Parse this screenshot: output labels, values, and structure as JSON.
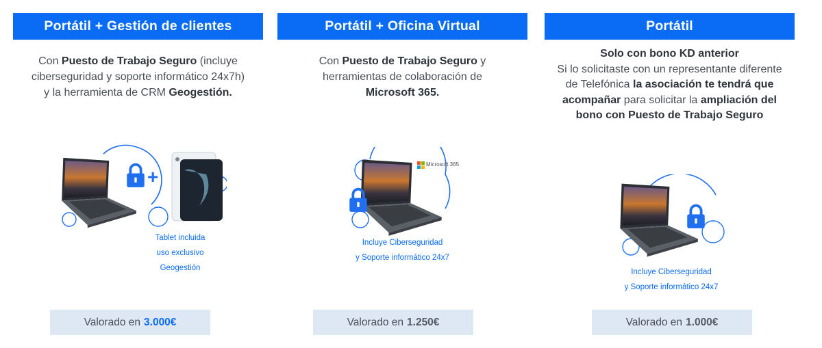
{
  "cards": [
    {
      "header": "Portátil + Gestión de clientes",
      "desc": {
        "p1": "Con ",
        "b1": "Puesto de Trabajo Seguro",
        "p2": " (incluye ciberseguridad y soporte informático 24x7h) y la herramienta de CRM ",
        "b2": "Geogestión."
      },
      "plus": "+",
      "caption": [
        "Tablet incluida",
        "uso exclusivo",
        "Geogestión"
      ],
      "price": {
        "label": "Valorado en",
        "amount": "3.000€"
      }
    },
    {
      "header": "Portátil + Oficina Virtual",
      "desc": {
        "p1": "Con ",
        "b1": "Puesto de Trabajo Seguro",
        "p2": " y herramientas de colaboración de ",
        "b2": "Microsoft 365."
      },
      "logo": "Microsoft 365",
      "caption": [
        "Incluye Ciberseguridad",
        "y Soporte informático 24x7"
      ],
      "price": {
        "label": "Valorado en",
        "amount": "1.250€"
      }
    },
    {
      "header": "Portátil",
      "desc": {
        "title": "Solo con bono KD anterior",
        "p1": "Si lo solicitaste con un representante diferente de Telefónica ",
        "b1": "la asociación te tendrá que acompañar",
        "p2": " para solicitar la ",
        "b2": "ampliación del bono con Puesto de Trabajo Seguro"
      },
      "caption": [
        "Incluye Ciberseguridad",
        "y Soporte informático 24x7"
      ],
      "price": {
        "label": "Valorado en",
        "amount": "1.000€"
      }
    }
  ],
  "colors": {
    "accent": "#0a6cf5",
    "price_bg": "#dde8f4",
    "text": "#4a4f57"
  },
  "icons": [
    "laptop-icon",
    "lock-icon",
    "tablet-icon",
    "microsoft-logo-icon"
  ]
}
